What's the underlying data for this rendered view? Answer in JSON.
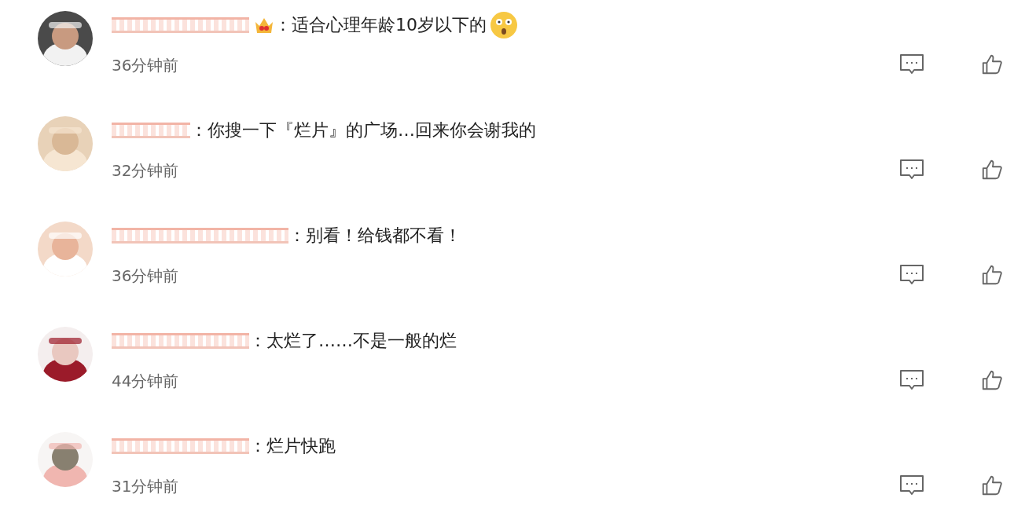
{
  "comments": [
    {
      "text": "：适合心理年龄10岁以下的",
      "time": "36分钟前",
      "badge": true,
      "emoji": true
    },
    {
      "text": "：你搜一下『烂片』的广场…回来你会谢我的",
      "time": "32分钟前",
      "badge": false,
      "emoji": false
    },
    {
      "text": "：别看！给钱都不看！",
      "time": "36分钟前",
      "badge": false,
      "emoji": false
    },
    {
      "text": "：太烂了……不是一般的烂",
      "time": "44分钟前",
      "badge": false,
      "emoji": false
    },
    {
      "text": "：烂片快跑",
      "time": "31分钟前",
      "badge": false,
      "emoji": false
    }
  ]
}
